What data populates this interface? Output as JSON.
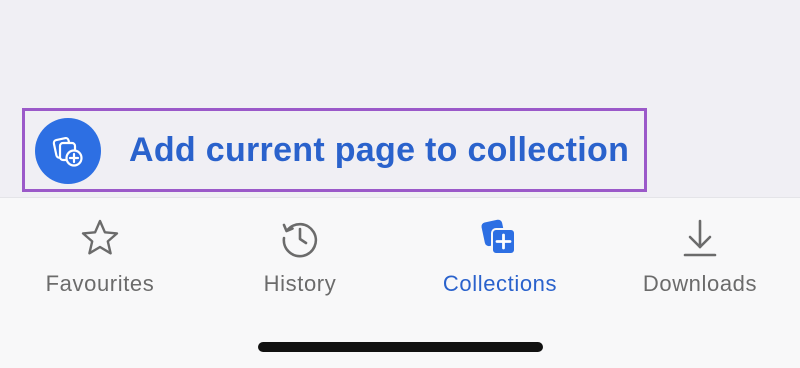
{
  "collection_action": {
    "label": "Add current page to collection",
    "icon": "add-to-collection-icon",
    "accent_color": "#2d6fe3",
    "highlight_color": "#9b59c9"
  },
  "tabs": [
    {
      "label": "Favourites",
      "icon": "star-icon",
      "active": false
    },
    {
      "label": "History",
      "icon": "history-icon",
      "active": false
    },
    {
      "label": "Collections",
      "icon": "collections-icon",
      "active": true
    },
    {
      "label": "Downloads",
      "icon": "download-icon",
      "active": false
    }
  ],
  "colors": {
    "active_tab": "#2a62cc",
    "inactive_tab": "#6b6b6b"
  }
}
